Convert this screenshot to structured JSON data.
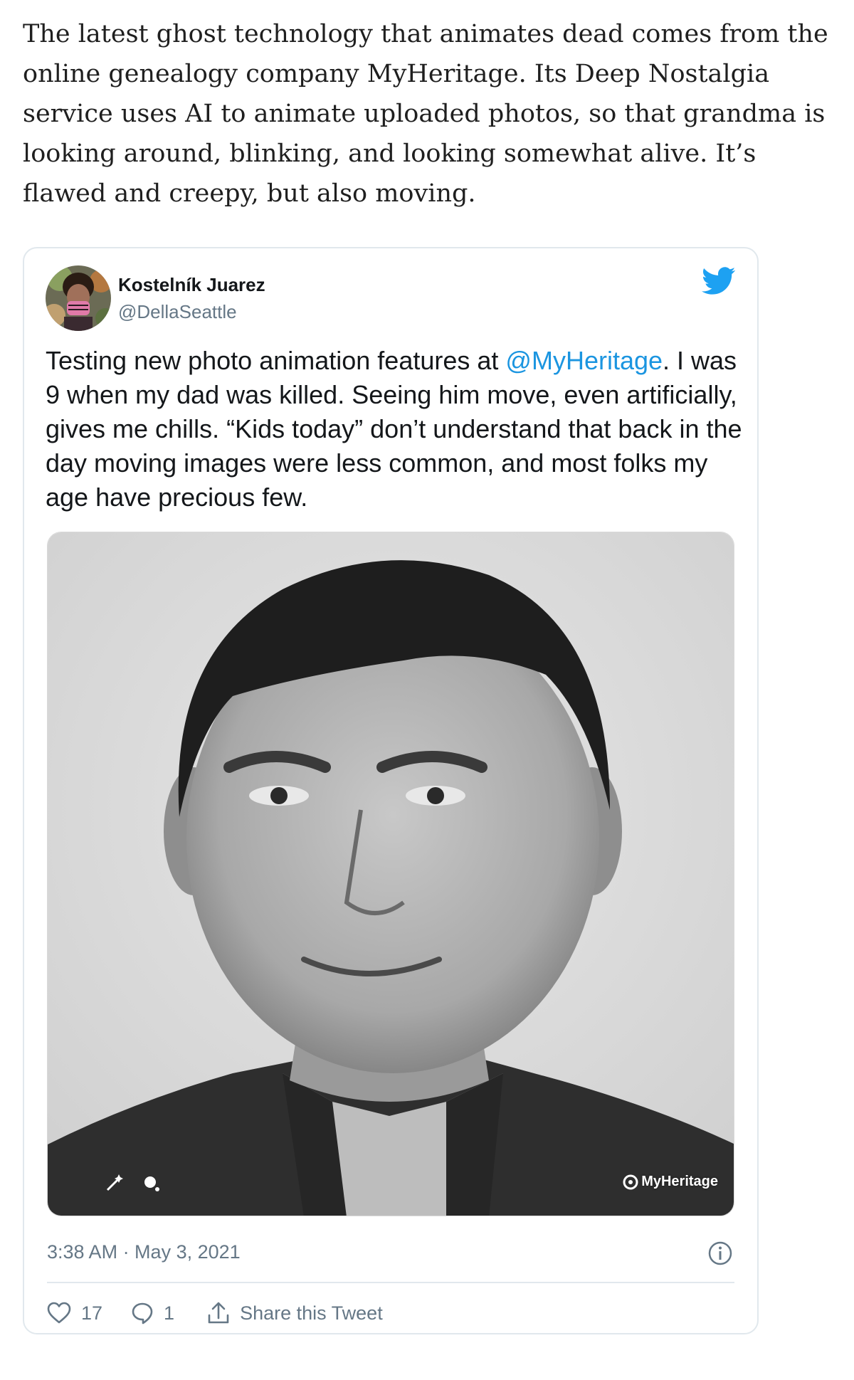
{
  "article": {
    "paragraph": "The latest ghost technology that animates dead comes from the online genealogy company MyHeritage. Its Deep Nostalgia service uses AI to animate uploaded photos, so that grandma is looking around, blinking, and looking somewhat alive. It’s flawed and creepy, but also moving."
  },
  "tweet": {
    "author_name": "Kostelník Juarez",
    "author_handle": "@DellaSeattle",
    "text_before": "Testing new photo animation features at ",
    "mention": "@MyHeritage",
    "text_after": ". I was 9 when my dad was killed. Seeing him move, even artificially, gives me chills. “Kids today” don’t understand that back in the day moving images were less common, and most folks my age have precious few.",
    "media_watermark": "MyHeritage",
    "timestamp": "3:38 AM · May 3, 2021",
    "likes": "17",
    "replies": "1",
    "share_label": "Share this Tweet"
  },
  "colors": {
    "twitter_blue": "#1da1f2",
    "mention_blue": "#1b95e0",
    "secondary_text": "#657786",
    "border": "#e1e8ed"
  },
  "icons": {
    "brand": "twitter-bird-icon",
    "info": "info-icon",
    "like": "heart-icon",
    "reply": "speech-bubble-icon",
    "share": "share-upload-icon",
    "media_controls": [
      "magic-wand-icon",
      "settings-dot-icon"
    ]
  }
}
